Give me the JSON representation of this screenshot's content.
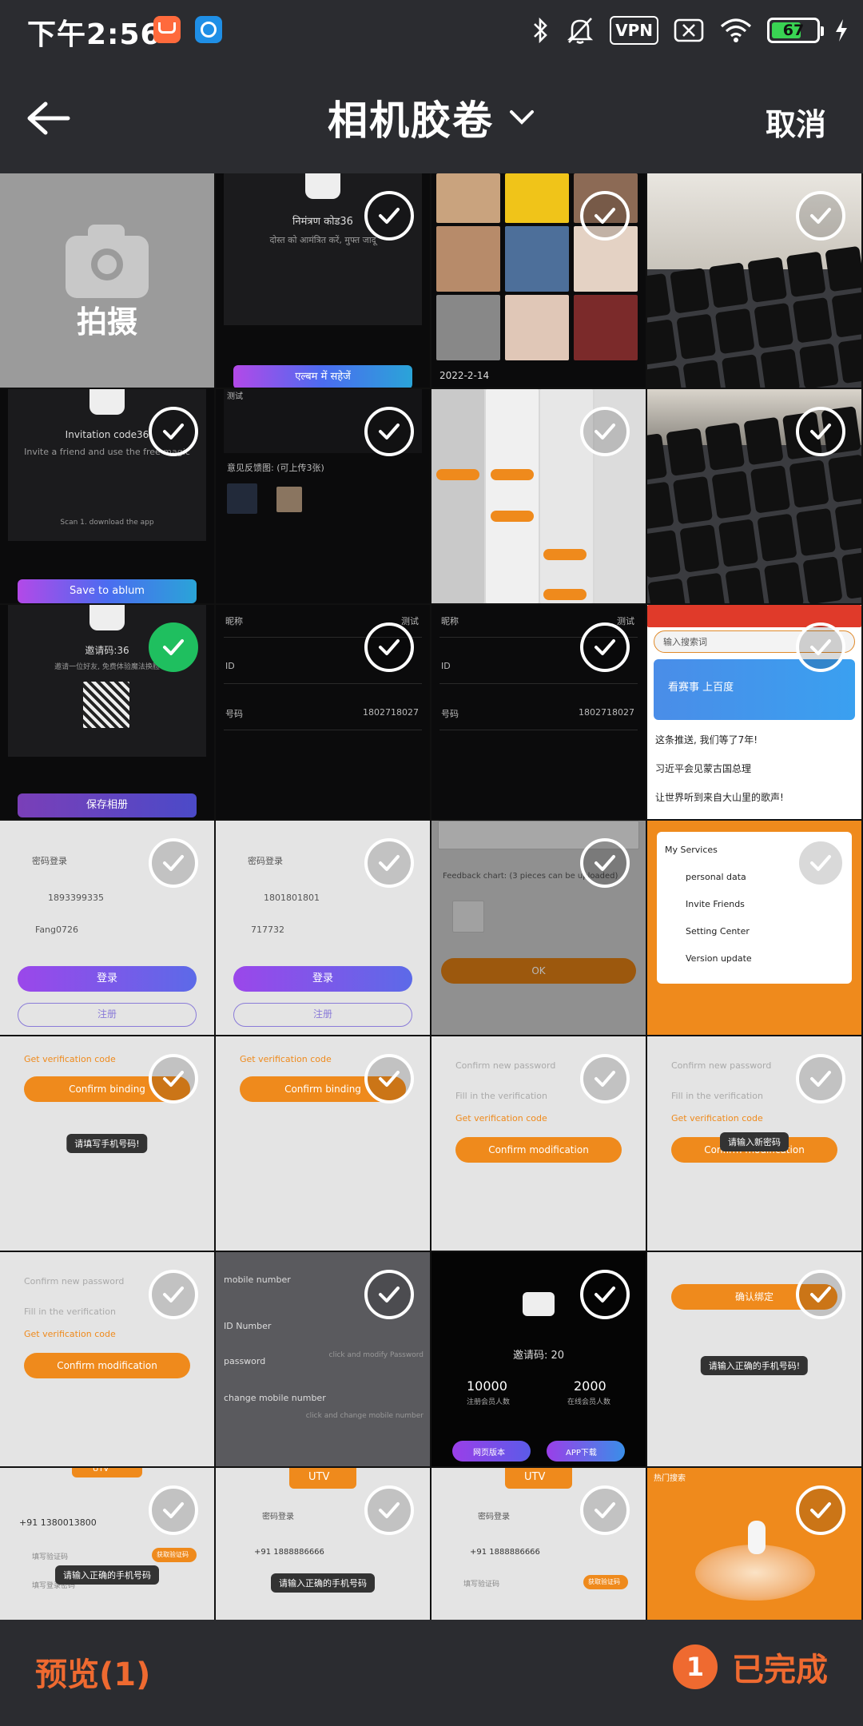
{
  "status_bar": {
    "time": "下午2:56",
    "vpn": "VPN",
    "battery": "67",
    "battery_level": 0.67
  },
  "header": {
    "title": "相机胶卷",
    "cancel": "取消"
  },
  "camera_tile": {
    "label": "拍摄"
  },
  "thumbs": {
    "t1": {
      "title": "निमंत्रण कोड36",
      "line": "दोस्त को आमंत्रित करें, मुफ्त जादू",
      "btn": "एल्बम में सहेजें"
    },
    "t2": {
      "date": "2022-2-14"
    },
    "t4": {
      "title": "Invitation code36",
      "line": "Invite a friend and use the free magic",
      "small": "Scan 1. download the app",
      "btn": "Save to ablum"
    },
    "t5": {
      "label": "意见反馈图: (可上传3张)",
      "label2": "测试"
    },
    "t8": {
      "title": "邀请码:36",
      "line": "邀请一位好友, 免费体验魔法换脸",
      "btn": "保存相册"
    },
    "t9": {
      "r1": "昵称",
      "r1v": "测试",
      "r2": "ID",
      "r3": "号码",
      "r3v": "1802718027"
    },
    "t11": {
      "search": "输入搜索词",
      "banner": "看赛事 上百度",
      "news1": "这条推送, 我们等了7年!",
      "news2": "习近平会见蒙古国总理",
      "news3": "让世界听到来自大山里的歌声!"
    },
    "t12": {
      "tab": "密码登录",
      "phone": "1893399335",
      "code": "Fang0726",
      "login": "登录",
      "register": "注册"
    },
    "t13": {
      "phone": "1801801801",
      "code": "717732"
    },
    "t14": {
      "text": "Feedback chart: (3 pieces can be uploaded)",
      "btn": "OK"
    },
    "t15": {
      "title": "My Services",
      "i1": "personal data",
      "i2": "Invite Friends",
      "i3": "Setting Center",
      "i4": "Version update"
    },
    "t16": {
      "l1": "Get verification code",
      "btn": "Confirm binding",
      "toast": "请填写手机号码!"
    },
    "t18": {
      "l1": "Confirm new password",
      "l2": "Fill in the verification",
      "l3": "Get verification code",
      "btn": "Confirm modification"
    },
    "t19": {
      "toast": "请输入新密码",
      "btn": "Confirm modification"
    },
    "t21": {
      "l1": "mobile number",
      "l2": "ID Number",
      "l3": "password",
      "l4": "change mobile number",
      "v3": "click and modify Password",
      "v4": "click and change mobile number"
    },
    "t22": {
      "title": "邀请码: 20",
      "n1": "10000",
      "n1l": "注册会员人数",
      "n2": "2000",
      "n2l": "在线会员人数",
      "b1": "网页版本",
      "b2": "APP下载"
    },
    "t23": {
      "btn": "确认绑定",
      "toast": "请输入正确的手机号码!"
    },
    "t24": {
      "brand": "UTV",
      "phone": "+91  1380013800",
      "code": "填写验证码",
      "pwd": "填写登录密码",
      "get": "获取验证码",
      "toast": "请输入正确的手机号码"
    },
    "t25": {
      "tab1": "密码登录",
      "phone": "+91  1888886666"
    },
    "t27": {
      "hot": "热门搜索"
    }
  },
  "bottom": {
    "preview": "预览(1)",
    "count": "1",
    "done": "已完成"
  },
  "colors": {
    "accent": "#ef6a30",
    "check_selected": "#1fbf5f",
    "chrome": "#2b2c30"
  }
}
